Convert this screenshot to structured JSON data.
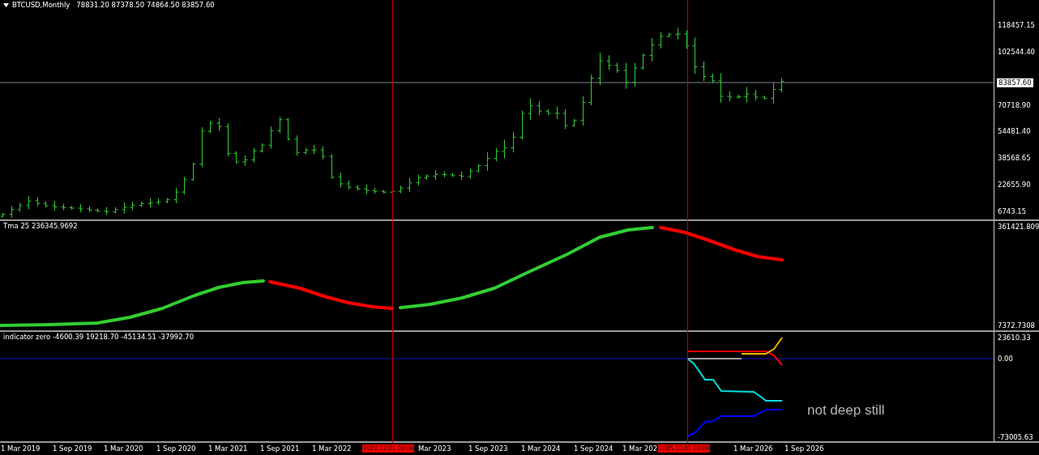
{
  "price_panel": {
    "title": "BTCUSD,Monthly",
    "ohlc": "78831.20 87378.50 74864.50 83857.60",
    "axis_ticks": [
      "118457.15",
      "102544.40",
      "70718.90",
      "54481.40",
      "38568.65",
      "22655.90",
      "6743.15"
    ],
    "current_price": "83857.60"
  },
  "tma_panel": {
    "label": "Tma 25 236345.9692",
    "axis_ticks": [
      "361421.809",
      "7372.7308"
    ]
  },
  "indicator_panel": {
    "label": "indicator zero -4600.39 19218.70 -45134.51 -37992.70",
    "axis_ticks": [
      "23610.33",
      "0.00",
      "-73005.63"
    ],
    "note": "not deep still"
  },
  "time_axis": {
    "labels": [
      "1 Mar 2019",
      "1 Sep 2019",
      "1 Mar 2020",
      "1 Sep 2020",
      "1 Mar 2021",
      "1 Sep 2021",
      "1 Mar 2022",
      "Mar 2023",
      "1 Sep 2023",
      "1 Mar 2024",
      "1 Sep 2024",
      "1 Mar 202",
      "1 Mar 2026",
      "1 Sep 2026"
    ],
    "markers": [
      {
        "label": "2022.12.01 00:00"
      },
      {
        "label": "2025.10.01 00:00"
      }
    ]
  }
}
